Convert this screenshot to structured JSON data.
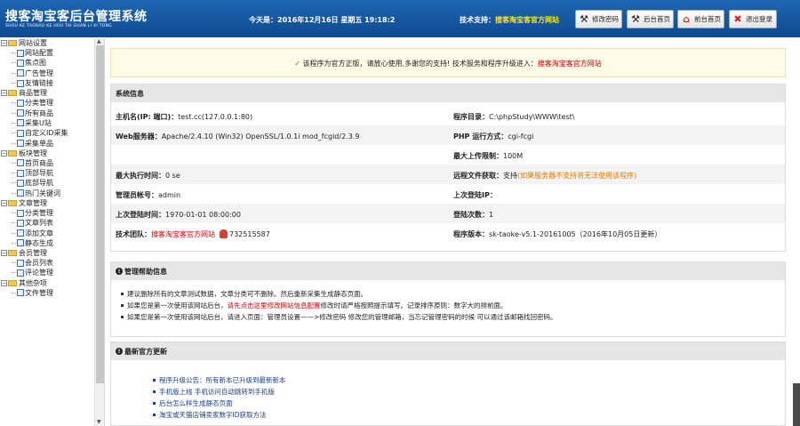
{
  "header": {
    "logo": "搜客淘宝客后台管理系统",
    "logo_sub": "SHOU KE TAOBAO KE HOU TAI GUAN LI XI TONG",
    "today": "今天是：2016年12月16日 星期五 19:18:2",
    "support_label": "技术支持：",
    "support_link": "搜客淘宝客官方网站",
    "buttons": [
      "修改密码",
      "后台首页",
      "前台首页",
      "退出登录"
    ]
  },
  "sidebar": {
    "groups": [
      {
        "label": "网站设置",
        "items": [
          "网站配置",
          "焦点图",
          "广告管理",
          "友情链接"
        ]
      },
      {
        "label": "商品管理",
        "items": [
          "分类管理",
          "所有商品",
          "采集U站",
          "自定义ID采集",
          "采集单品"
        ]
      },
      {
        "label": "板块管理",
        "items": [
          "首页商品",
          "顶部导航",
          "底部导航",
          "热门关键词"
        ]
      },
      {
        "label": "文章管理",
        "items": [
          "分类管理",
          "文章列表",
          "添加文章",
          "静态生成"
        ]
      },
      {
        "label": "会员管理",
        "items": [
          "会员列表",
          "评论管理"
        ]
      },
      {
        "label": "其他杂项",
        "items": [
          "文件管理"
        ]
      }
    ]
  },
  "notice": {
    "text": "该程序为官方正版，请放心使用,多谢您的支持! 技术服务和程序升级进入：",
    "link": "搜客淘宝客官方网站"
  },
  "sysinfo": {
    "title": "系统信息",
    "host_label": "主机名(IP: 端口)：",
    "host_value": "test.cc(127.0.0.1:80)",
    "dir_label": "程序目录：",
    "dir_value": "C:\\phpStudy\\WWW\\test\\",
    "web_label": "Web服务器：",
    "web_value": "Apache/2.4.10 (Win32) OpenSSL/1.0.1i mod_fcgid/2.3.9",
    "php_label": "PHP 运行方式：",
    "php_value": "cgi-fcgi",
    "upload_label": "最大上传限制：",
    "upload_value": "100M",
    "exec_label": "最大执行时间：",
    "exec_value": "0 se",
    "remote_label": "远程文件获取：",
    "remote_value": "支持",
    "remote_note": "(如果服务器不支持将无法使用该程序)",
    "admin_label": "管理员帐号：",
    "admin_value": "admin",
    "lastip_label": "上次登陆IP：",
    "lastip_value": "",
    "lasttime_label": "上次登陆时间：",
    "lasttime_value": "1970-01-01 08:00:00",
    "logins_label": "登陆次数：",
    "logins_value": "1",
    "team_label": "技术团队：",
    "team_value": "搜客淘宝客官方网站",
    "qq_value": "732515587",
    "ver_label": "程序版本：",
    "ver_value": "sk-taoke-v5.1-20161005（2016年10月05日更新）"
  },
  "help": {
    "title": "管理帮助信息",
    "items": [
      {
        "a": "建议删除所有的文章测试数据，文章分类可不删除。然后重新采集生成静态页面。",
        "b": "",
        "c": ""
      },
      {
        "a": "如果您是第一次使用该网站后台，",
        "b": "请先点击这里修改网站信息配置",
        "c": " 修改时请严格按照提示填写。记录排序原则：数字大的排前面。"
      },
      {
        "a": "如果您是第一次使用该网站后台，请进入页面：管理员设置——>修改密码 修改您的管理邮箱，当忘记管理密码的时候 可以通过该邮箱找回密码。",
        "b": "",
        "c": ""
      }
    ]
  },
  "news": {
    "title": "最新官方更新",
    "items": [
      "程序升级公告：所有新本已升级到最新新本",
      "手机版上线 手机访问自动跳转到手机版",
      "后台怎么样生成静态页面",
      "淘宝或天猫店铺卖家数字ID获取方法"
    ]
  }
}
